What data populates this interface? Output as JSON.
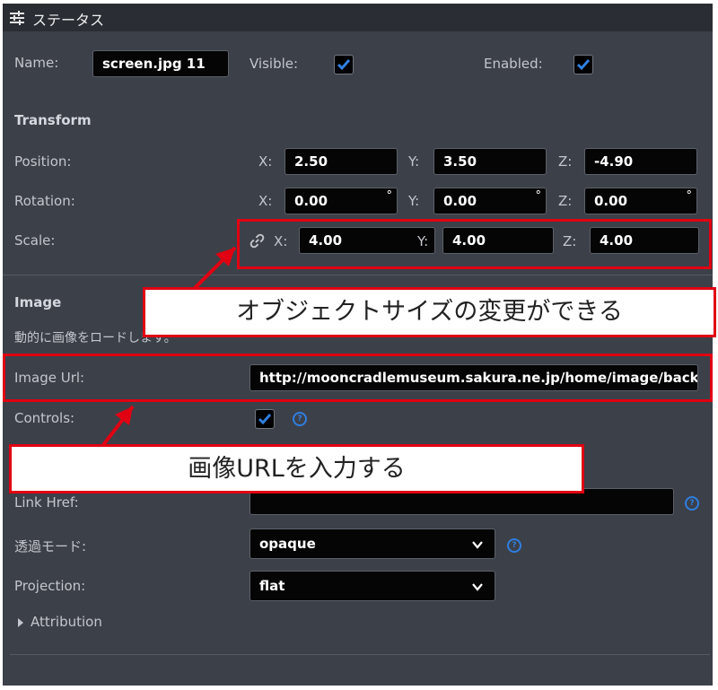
{
  "header": {
    "title": "ステータス",
    "icon": "sliders-icon"
  },
  "object": {
    "name_label": "Name:",
    "name_value": "screen.jpg 11",
    "visible_label": "Visible:",
    "visible_checked": true,
    "enabled_label": "Enabled:",
    "enabled_checked": true
  },
  "transform": {
    "title": "Transform",
    "position": {
      "label": "Position:",
      "x": "2.50",
      "y": "3.50",
      "z": "-4.90"
    },
    "rotation": {
      "label": "Rotation:",
      "x": "0.00",
      "y": "0.00",
      "z": "0.00",
      "unit": "°"
    },
    "scale": {
      "label": "Scale:",
      "x": "4.00",
      "y": "4.00",
      "z": "4.00",
      "link_icon": "link-icon"
    },
    "axis_x": "X:",
    "axis_y": "Y:",
    "axis_z": "Z:"
  },
  "image": {
    "title": "Image",
    "description": "動的に画像をロードします。",
    "url_label": "Image Url:",
    "url_value": "http://mooncradlemuseum.sakura.ne.jp/home/image/backg",
    "controls_label": "Controls:",
    "controls_checked": true,
    "link_href_label": "Link Href:",
    "link_href_value": "",
    "transparency_label": "透過モード:",
    "transparency_value": "opaque",
    "projection_label": "Projection:",
    "projection_value": "flat",
    "attribution_label": "Attribution"
  },
  "annotations": {
    "scale_callout": "オブジェクトサイズの変更ができる",
    "url_callout": "画像URLを入力する"
  },
  "colors": {
    "panel": "#3c4049",
    "header": "#2a2d33",
    "accent": "#2f7fe0",
    "annotation": "#e00012"
  }
}
